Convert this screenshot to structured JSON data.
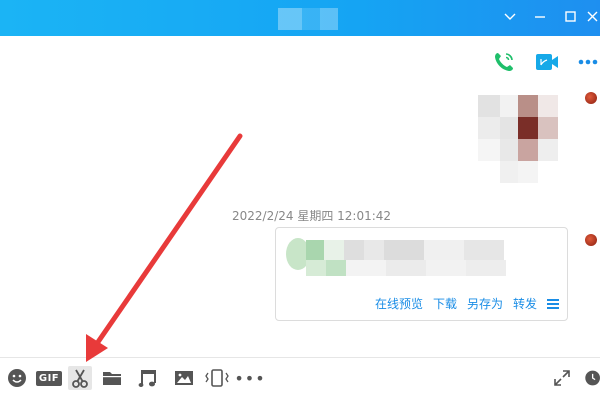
{
  "window": {
    "title_bar_color": "#1aa6f3",
    "controls": [
      {
        "name": "collapse-chevron-icon"
      },
      {
        "name": "minimize-icon"
      },
      {
        "name": "maximize-icon"
      },
      {
        "name": "close-icon"
      }
    ]
  },
  "header": {
    "actions": [
      {
        "name": "voice-call-icon",
        "color": "#1fbf6b"
      },
      {
        "name": "video-call-icon",
        "color": "#16a9e8"
      },
      {
        "name": "more-options-icon",
        "color": "#1a8de6"
      }
    ]
  },
  "chat": {
    "timestamp": "2022/2/24 星期四 12:01:42",
    "file_card": {
      "actions": [
        "在线预览",
        "下载",
        "另存为",
        "转发"
      ],
      "accent_color": "#1a8de6"
    }
  },
  "toolbar": {
    "gif_label": "GIF",
    "more_label": "•••",
    "tools": [
      "emoji-icon",
      "gif-icon",
      "scissors-screenshot-icon",
      "folder-icon",
      "music-note-icon",
      "image-icon",
      "shake-window-icon",
      "more-icon"
    ],
    "active_tool": "scissors-screenshot-icon",
    "annotation_arrow_color": "#e83a3a"
  }
}
